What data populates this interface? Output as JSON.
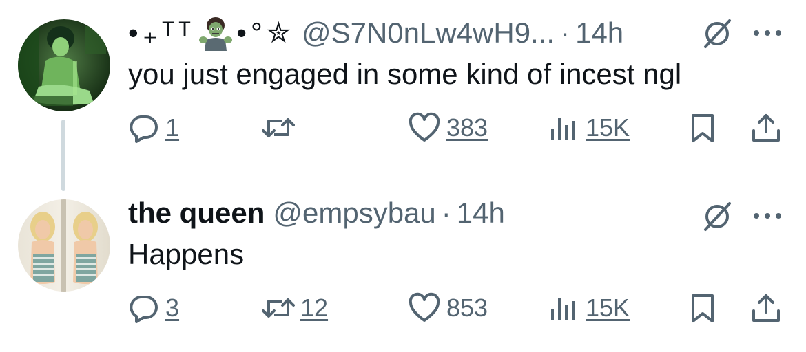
{
  "tweets": [
    {
      "display_name_parts": [
        "•",
        "₊",
        "ᵀᵀ",
        "•",
        "°✮"
      ],
      "avatar_emoji_name": "zombie-emoji",
      "handle": "@S7N0nLw4wH9...",
      "separator": "·",
      "time": "14h",
      "text": "you just engaged in some kind of incest ngl",
      "actions": {
        "replies": "1",
        "retweets": "",
        "likes": "383",
        "views": "15K"
      },
      "icons": [
        "reply-icon",
        "retweet-icon",
        "like-icon",
        "views-icon",
        "bookmark-icon",
        "share-icon",
        "grok-icon",
        "more-icon"
      ]
    },
    {
      "display_name": "the queen",
      "handle": "@empsybau",
      "separator": "·",
      "time": "14h",
      "text": "Happens",
      "actions": {
        "replies": "3",
        "retweets": "12",
        "likes": "853",
        "views": "15K"
      },
      "icons": [
        "reply-icon",
        "retweet-icon",
        "like-icon",
        "views-icon",
        "bookmark-icon",
        "share-icon",
        "grok-icon",
        "more-icon"
      ]
    }
  ],
  "colors": {
    "text": "#0f1419",
    "secondary": "#536471",
    "thread_line": "#cfd9de",
    "background": "#ffffff"
  }
}
